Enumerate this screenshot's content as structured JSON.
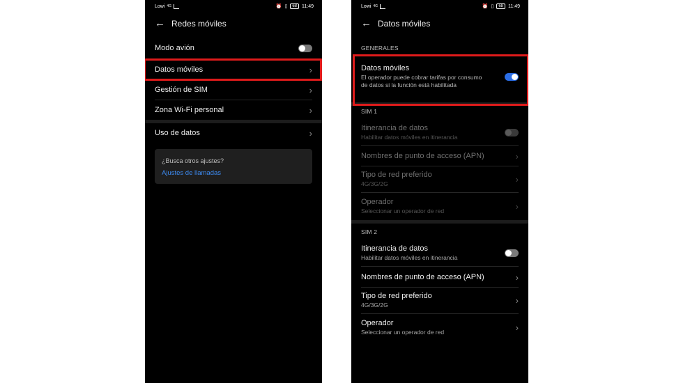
{
  "status": {
    "carrier": "Lowi",
    "network": "4G",
    "battery": "68",
    "time": "11:49"
  },
  "left": {
    "title": "Redes móviles",
    "items": [
      {
        "label": "Modo avión"
      },
      {
        "label": "Datos móviles"
      },
      {
        "label": "Gestión de SIM"
      },
      {
        "label": "Zona Wi-Fi personal"
      },
      {
        "label": "Uso de datos"
      }
    ],
    "card": {
      "question": "¿Busca otros ajustes?",
      "link": "Ajustes de llamadas"
    }
  },
  "right": {
    "title": "Datos móviles",
    "generales_label": "GENERALES",
    "datos": {
      "label": "Datos móviles",
      "desc": "El operador puede cobrar tarifas por consumo de datos si la función está habilitada"
    },
    "sim1": {
      "label": "SIM 1",
      "items": [
        {
          "label": "Itinerancia de datos",
          "sub": "Habilitar datos móviles en itinerancia"
        },
        {
          "label": "Nombres de punto de acceso (APN)"
        },
        {
          "label": "Tipo de red preferido",
          "sub": "4G/3G/2G"
        },
        {
          "label": "Operador",
          "sub": "Seleccionar un operador de red"
        }
      ]
    },
    "sim2": {
      "label": "SIM 2",
      "items": [
        {
          "label": "Itinerancia de datos",
          "sub": "Habilitar datos móviles en itinerancia"
        },
        {
          "label": "Nombres de punto de acceso (APN)"
        },
        {
          "label": "Tipo de red preferido",
          "sub": "4G/3G/2G"
        },
        {
          "label": "Operador",
          "sub": "Seleccionar un operador de red"
        }
      ]
    }
  },
  "colors": {
    "highlight": "#e01b1b",
    "toggle_on": "#2b6ee6",
    "link": "#3d8bf2"
  }
}
